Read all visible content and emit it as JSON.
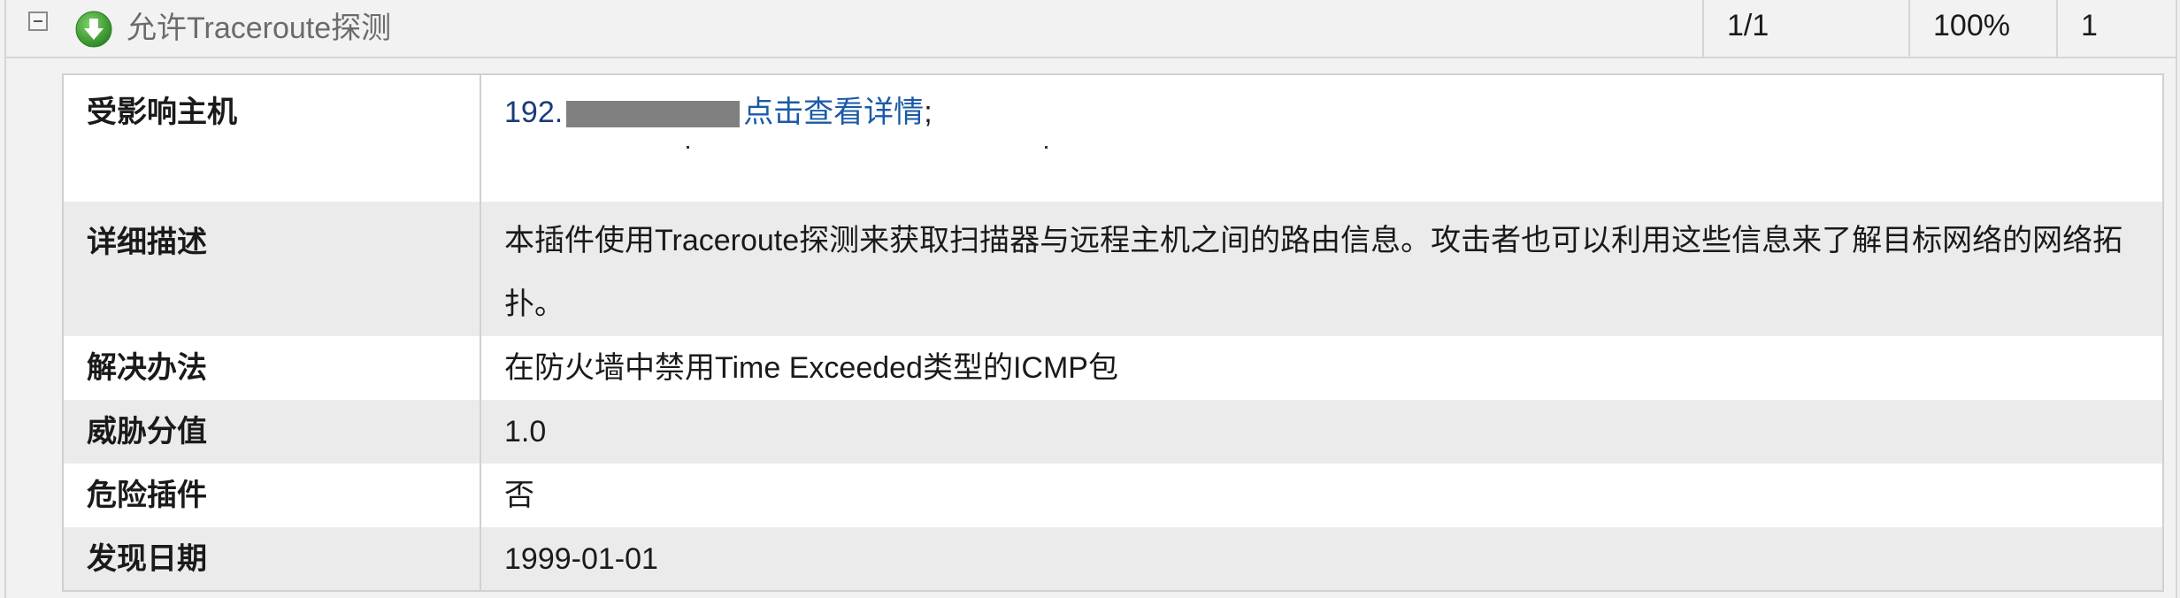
{
  "header": {
    "plugin_name": "允许Traceroute探测",
    "ratio": "1/1",
    "percent": "100%",
    "count": "1",
    "status_color": "#3a9a2e"
  },
  "details": {
    "affected_hosts": {
      "label": "受影响主机",
      "ip_prefix": "192.",
      "link_text": "点击查看详情",
      "suffix": ";"
    },
    "description": {
      "label": "详细描述",
      "value": "本插件使用Traceroute探测来获取扫描器与远程主机之间的路由信息。攻击者也可以利用这些信息来了解目标网络的网络拓扑。"
    },
    "solution": {
      "label": "解决办法",
      "value": "在防火墙中禁用Time Exceeded类型的ICMP包"
    },
    "threat_score": {
      "label": "威胁分值",
      "value": "1.0"
    },
    "dangerous_plugin": {
      "label": "危险插件",
      "value": "否"
    },
    "discovery_date": {
      "label": "发现日期",
      "value": "1999-01-01"
    }
  }
}
